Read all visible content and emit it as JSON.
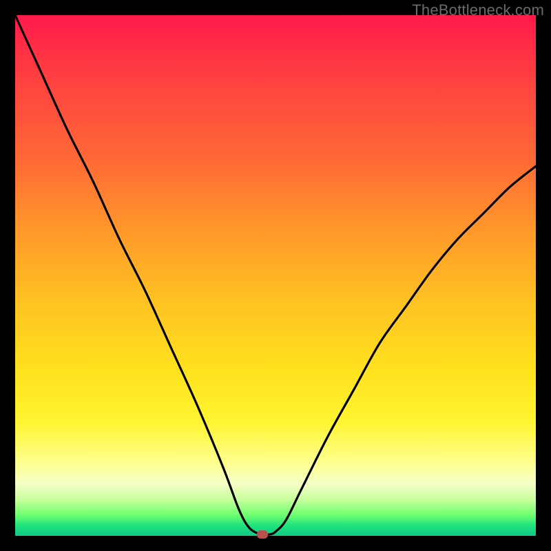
{
  "watermark": "TheBottleneck.com",
  "colors": {
    "frame": "#000000",
    "gradient_top": "#ff1a4b",
    "gradient_mid": "#ffe11e",
    "gradient_bottom": "#0fc885",
    "curve": "#000000",
    "marker": "#b9504b"
  },
  "chart_data": {
    "type": "line",
    "title": "",
    "xlabel": "",
    "ylabel": "",
    "xlim": [
      0,
      100
    ],
    "ylim": [
      0,
      100
    ],
    "series": [
      {
        "name": "bottleneck-curve",
        "x": [
          0,
          5,
          10,
          15,
          20,
          25,
          30,
          35,
          40,
          43,
          45,
          47,
          47.5,
          49,
          50,
          52,
          55,
          60,
          65,
          70,
          75,
          80,
          85,
          90,
          95,
          100
        ],
        "values": [
          100,
          89,
          78,
          68,
          57,
          47,
          36,
          25,
          13,
          5,
          1.5,
          0.3,
          0.2,
          0.3,
          0.8,
          3,
          9,
          19,
          28,
          37,
          44,
          51,
          57,
          62,
          67,
          71
        ]
      }
    ],
    "marker": {
      "x": 47.5,
      "y": 0.2
    },
    "flat_segment": {
      "x_start": 43,
      "x_end": 49,
      "y": 0.2
    }
  }
}
